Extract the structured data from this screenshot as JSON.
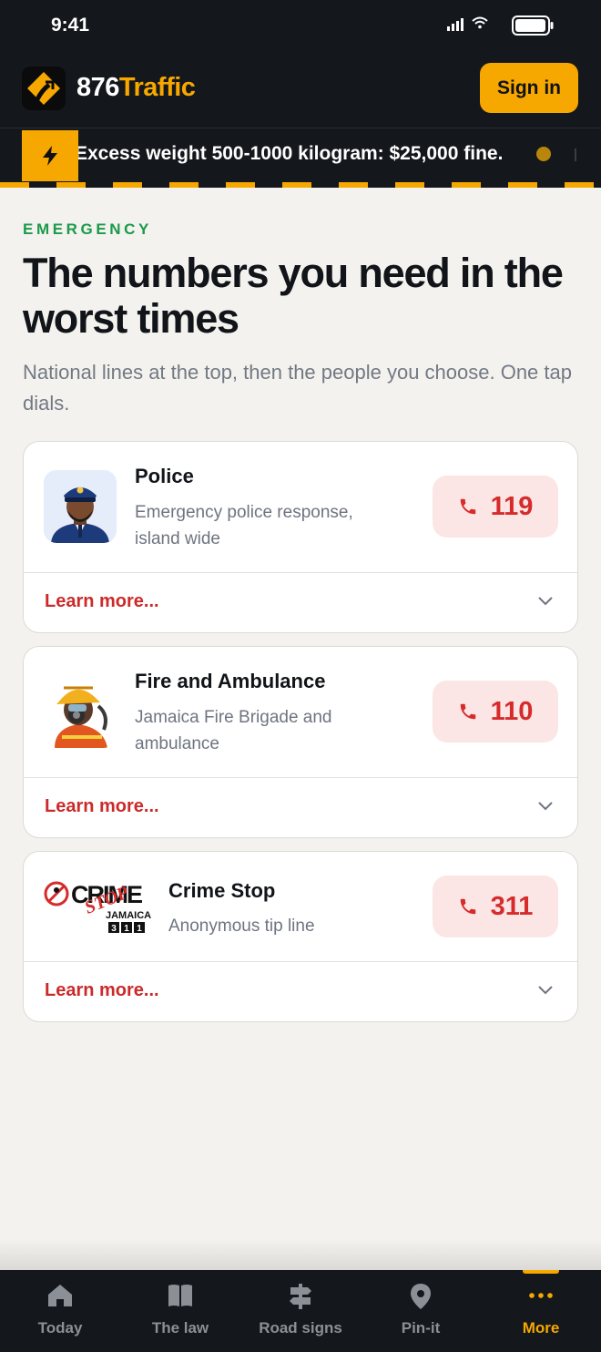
{
  "status_bar": {
    "time": "9:41"
  },
  "header": {
    "brand_part1": "876",
    "brand_part2": "Traffic",
    "sign_in_label": "Sign in",
    "colors": {
      "accent": "#f6a800",
      "bar": "#14171c"
    }
  },
  "ticker": {
    "text": "Excess weight 500-1000 kilogram: $25,000 fine."
  },
  "section": {
    "eyebrow": "EMERGENCY",
    "title": "The numbers you need in the worst times",
    "subtitle": "National lines at the top, then the people you choose. One tap dials."
  },
  "contacts": [
    {
      "name": "Police",
      "description": "Emergency police response, island wide",
      "number": "119",
      "learn_more": "Learn more...",
      "icon": "police-officer-avatar"
    },
    {
      "name": "Fire and Ambulance",
      "description": "Jamaica Fire Brigade and ambulance",
      "number": "110",
      "learn_more": "Learn more...",
      "icon": "firefighter-avatar"
    },
    {
      "name": "Crime Stop",
      "description": "Anonymous tip line",
      "number": "311",
      "learn_more": "Learn more...",
      "icon": "crime-stop-logo"
    }
  ],
  "crime_logo": {
    "word": "CRIME",
    "stop": "STOP",
    "country": "JAMAICA",
    "digits": [
      "3",
      "1",
      "1"
    ]
  },
  "nav": {
    "items": [
      {
        "label": "Today",
        "icon": "home-icon"
      },
      {
        "label": "The law",
        "icon": "book-icon"
      },
      {
        "label": "Road signs",
        "icon": "signpost-icon"
      },
      {
        "label": "Pin-it",
        "icon": "pin-icon"
      },
      {
        "label": "More",
        "icon": "more-icon",
        "active": true
      }
    ]
  },
  "colors": {
    "emergency_green": "#1a9a4b",
    "call_red": "#d62b2b",
    "call_bg": "#fbe5e5"
  }
}
